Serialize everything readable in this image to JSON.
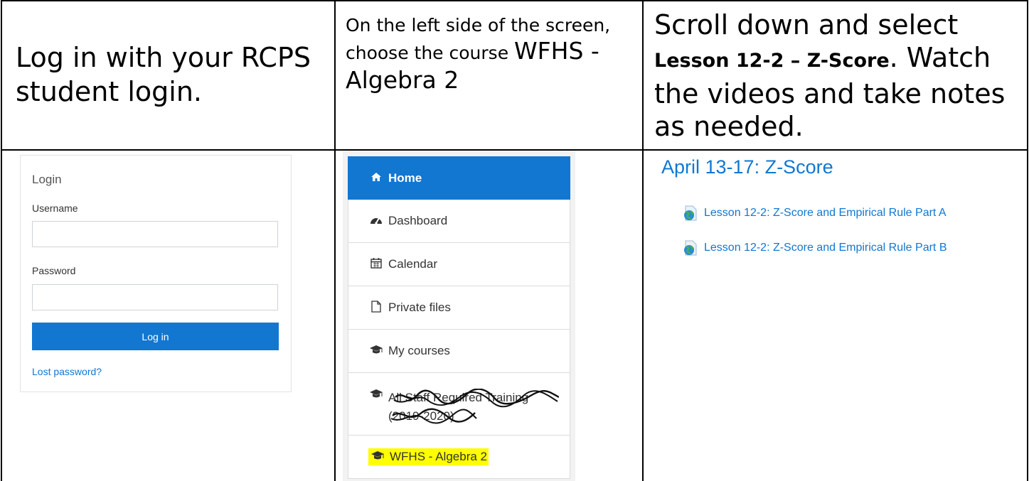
{
  "step1": {
    "text": "Log in with your RCPS student login."
  },
  "step2": {
    "text_small": "On the left side of the screen, choose the",
    "text_prefix": "course",
    "course": "WFHS - Algebra 2"
  },
  "step3": {
    "text_before": "Scroll down and select",
    "lesson": "Lesson 12-2 – Z-Score",
    "text_after": ". Watch the videos and take notes as needed."
  },
  "login": {
    "title": "Login",
    "username_label": "Username",
    "username_value": "",
    "password_label": "Password",
    "password_value": "",
    "button": "Log in",
    "lost_password": "Lost password?"
  },
  "nav": {
    "items": [
      {
        "label": "Home",
        "icon": "home-icon",
        "active": true
      },
      {
        "label": "Dashboard",
        "icon": "dashboard-icon"
      },
      {
        "label": "Calendar",
        "icon": "calendar-icon"
      },
      {
        "label": "Private files",
        "icon": "file-icon"
      },
      {
        "label": "My courses",
        "icon": "graduation-cap-icon"
      },
      {
        "label": "All Staff Required Training (2019-2020)",
        "icon": "graduation-cap-icon",
        "scribbled": true
      },
      {
        "label": "WFHS - Algebra 2",
        "icon": "graduation-cap-icon",
        "highlighted": true
      }
    ]
  },
  "course": {
    "section_title": "April 13-17: Z-Score",
    "lessons": [
      "Lesson 12-2: Z-Score and Empirical Rule Part A",
      "Lesson 12-2: Z-Score and Empirical Rule Part B"
    ]
  },
  "colors": {
    "accent": "#1177d1",
    "highlight": "#ffff00"
  }
}
